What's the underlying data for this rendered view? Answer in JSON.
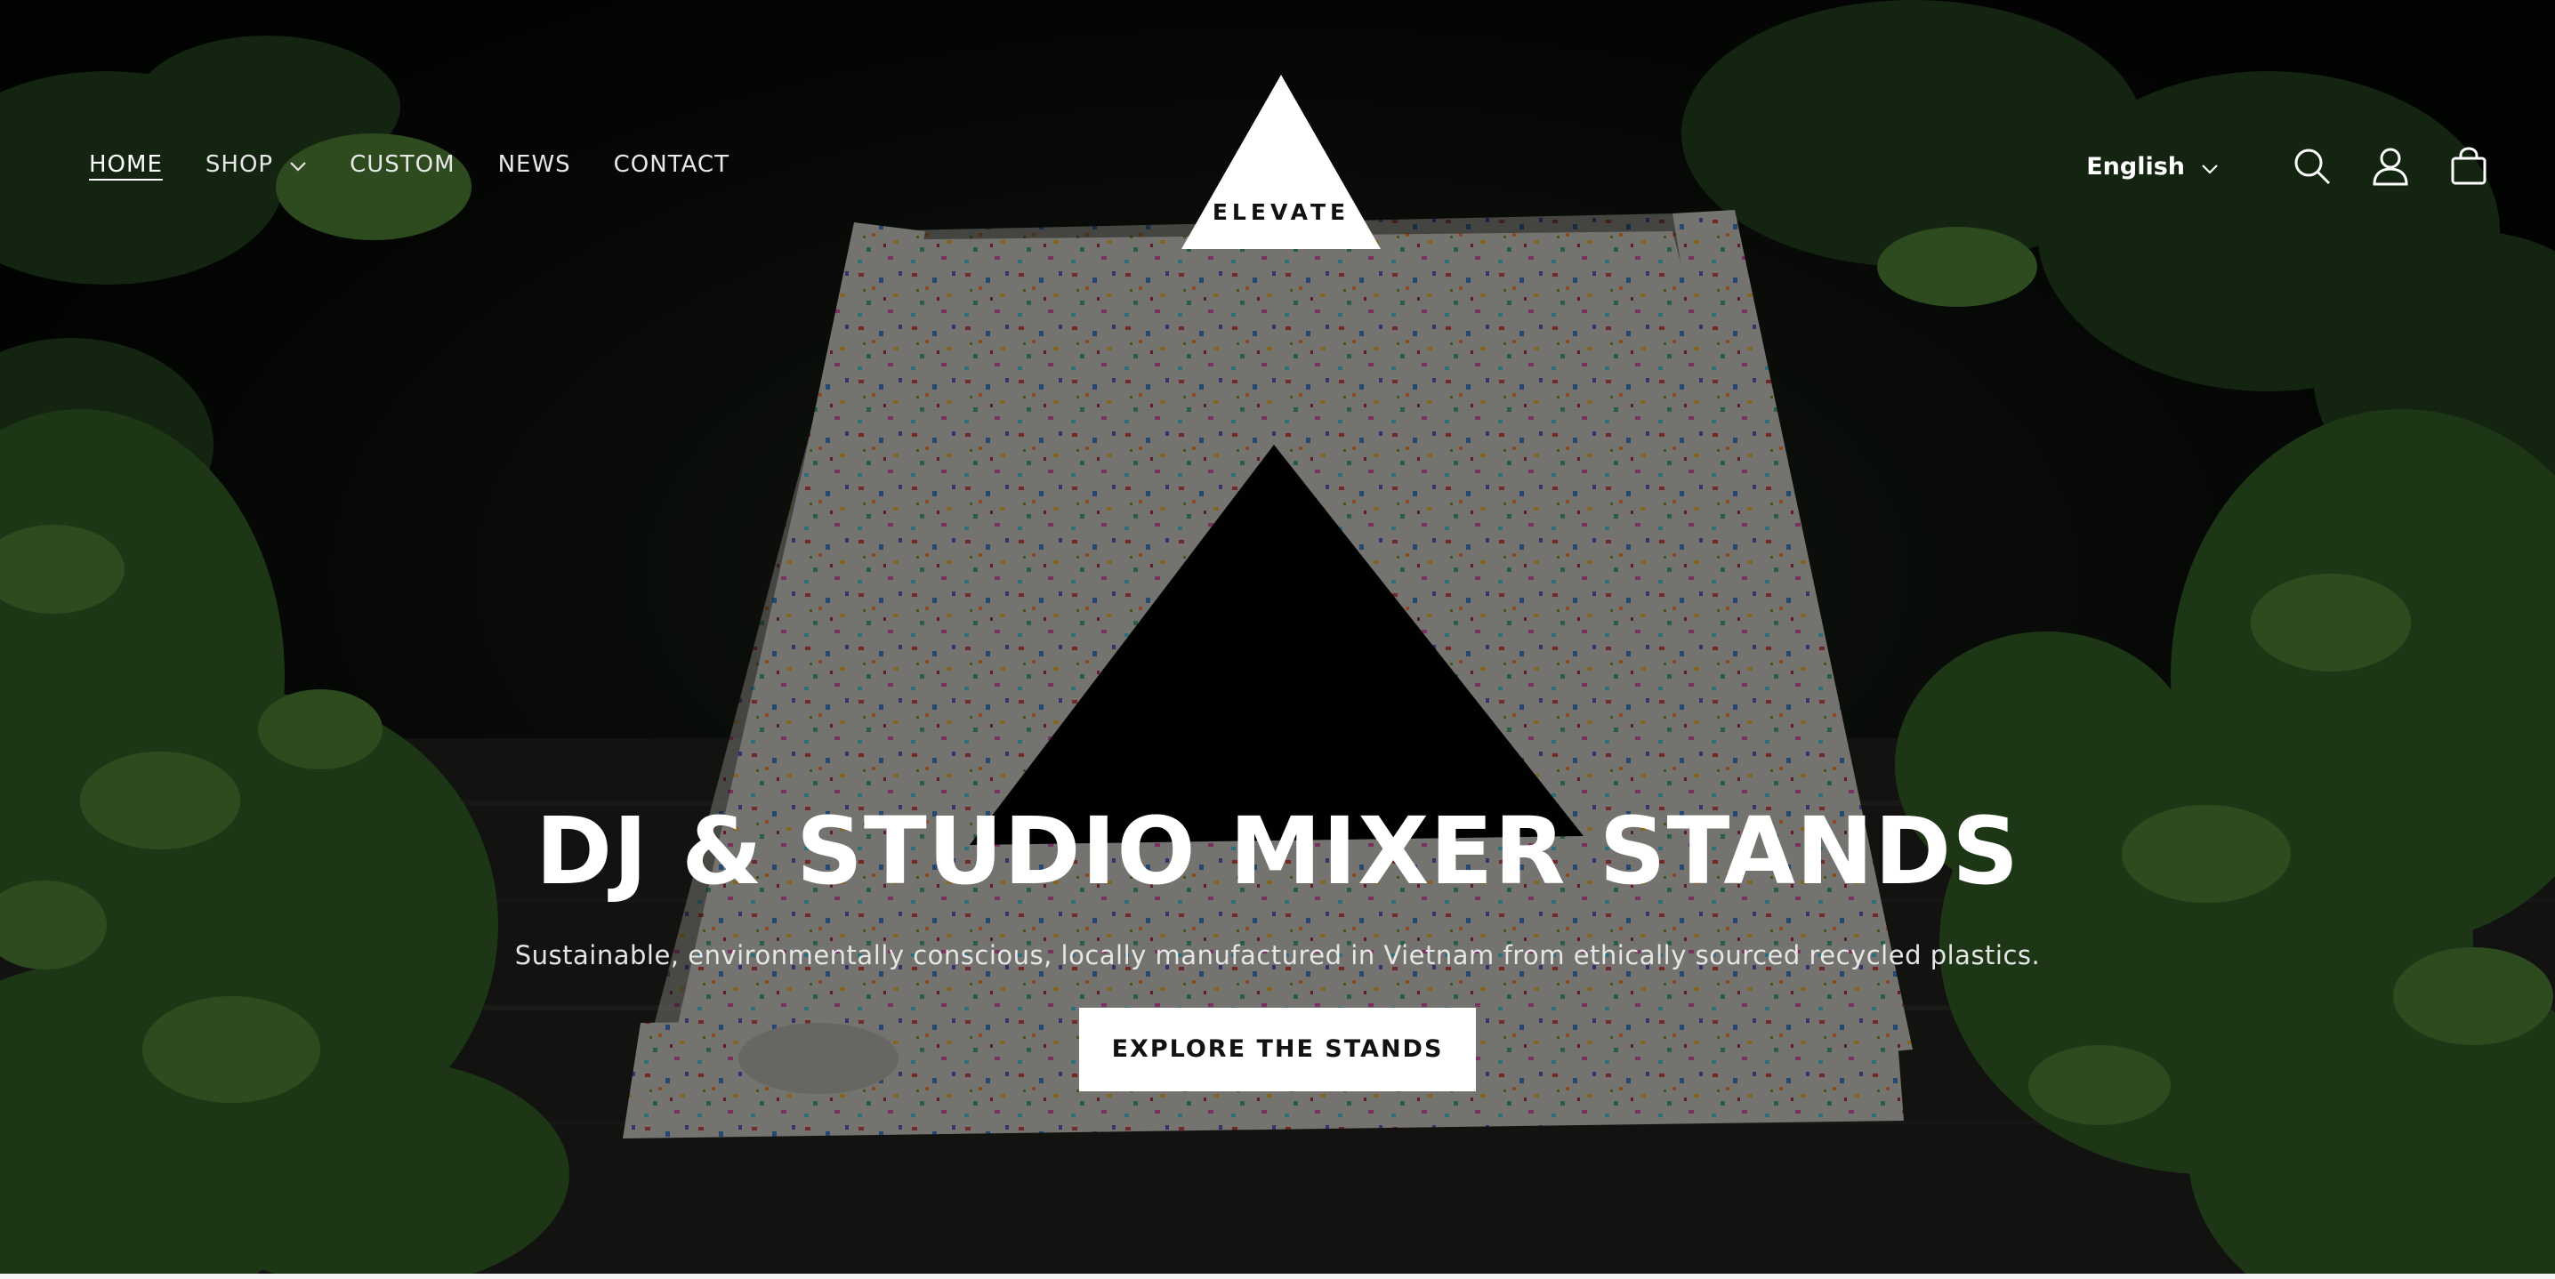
{
  "header": {
    "nav": [
      {
        "label": "HOME",
        "active": true
      },
      {
        "label": "SHOP",
        "has_dropdown": true
      },
      {
        "label": "CUSTOM"
      },
      {
        "label": "NEWS"
      },
      {
        "label": "CONTACT"
      }
    ],
    "logo_text": "ELEVATE",
    "language": "English",
    "icons": [
      "search-icon",
      "account-icon",
      "cart-icon",
      "chevron-down-icon"
    ]
  },
  "hero": {
    "title": "DJ & STUDIO MIXER STANDS",
    "subtitle": "Sustainable, environmentally conscious, locally manufactured in Vietnam from ethically sourced recycled plastics.",
    "cta_label": "EXPLORE THE STANDS"
  },
  "colors": {
    "background": "#050805",
    "text": "#ffffff",
    "button_bg": "#ffffff",
    "button_text": "#121212"
  }
}
